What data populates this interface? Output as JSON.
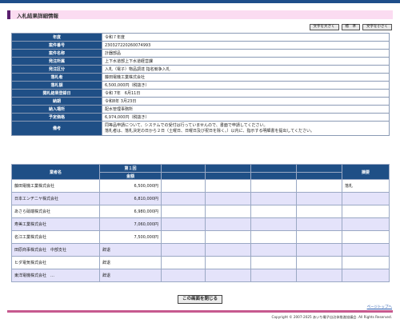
{
  "header": {
    "title": "入札結果詳細情報"
  },
  "font_buttons": {
    "larger": "文字を大きく",
    "standard": "標　準",
    "smaller": "文字を小さく"
  },
  "info_rows": [
    {
      "label": "年度",
      "value": "令和７年度"
    },
    {
      "label": "案件番号",
      "value": "230327220260074993"
    },
    {
      "label": "案件名称",
      "value": "計器部品"
    },
    {
      "label": "発注所属",
      "value": "上下水道部上下水道経営課"
    },
    {
      "label": "発注区分",
      "value": "入札（電子）物品調達 指名競争入札"
    },
    {
      "label": "落札者",
      "value": "藤田電機工業株式会社"
    },
    {
      "label": "落札額",
      "value": "6,500,000円（税抜き）"
    },
    {
      "label": "開札結果登録日",
      "value": "令和 7年　6月11日"
    },
    {
      "label": "納期",
      "value": "令和8年 3月23日"
    },
    {
      "label": "納入場所",
      "value": "配水管理事務所"
    },
    {
      "label": "予定価格",
      "value": "6,974,000円（税抜き）"
    }
  ],
  "remarks": {
    "label": "備考",
    "line1": "同等品申請について、システムでの受付は行っていませんので、書面で申請してください。",
    "line2": "落札者は、落札決定の日から２日（土曜日、日曜日及び祝日を除く。）以内に、指示する明細書を提出してください。"
  },
  "bids_table": {
    "bidder_header": "業者名",
    "round_header": "第１回",
    "amount_header": "金額",
    "result_header": "摘要",
    "rows": [
      {
        "name": "藤田電機工業株式会社",
        "amount": "6,500,000円",
        "remark": "落札"
      },
      {
        "name": "日本エンヂニヤ株式会社",
        "amount": "6,810,000円",
        "remark": ""
      },
      {
        "name": "あさら硝端株式会社",
        "amount": "6,980,000円",
        "remark": ""
      },
      {
        "name": "寿美工業株式会社",
        "amount": "7,060,000円",
        "remark": ""
      },
      {
        "name": "名江工業株式会社",
        "amount": "7,500,000円",
        "remark": ""
      },
      {
        "name": "田原商事株式会社　中部支社",
        "amount": "辞退",
        "remark": ""
      },
      {
        "name": "ヒダ電気株式会社",
        "amount": "辞退",
        "remark": ""
      },
      {
        "name": "東洋電機株式会社　…",
        "amount": "辞退",
        "remark": ""
      }
    ]
  },
  "close_button": "この画面を閉じる",
  "page_top_link": "ページトップへ",
  "copyright": "Copyright © 2007-2025 あいち電子自治体推進協議会. All Rights Reserved."
}
